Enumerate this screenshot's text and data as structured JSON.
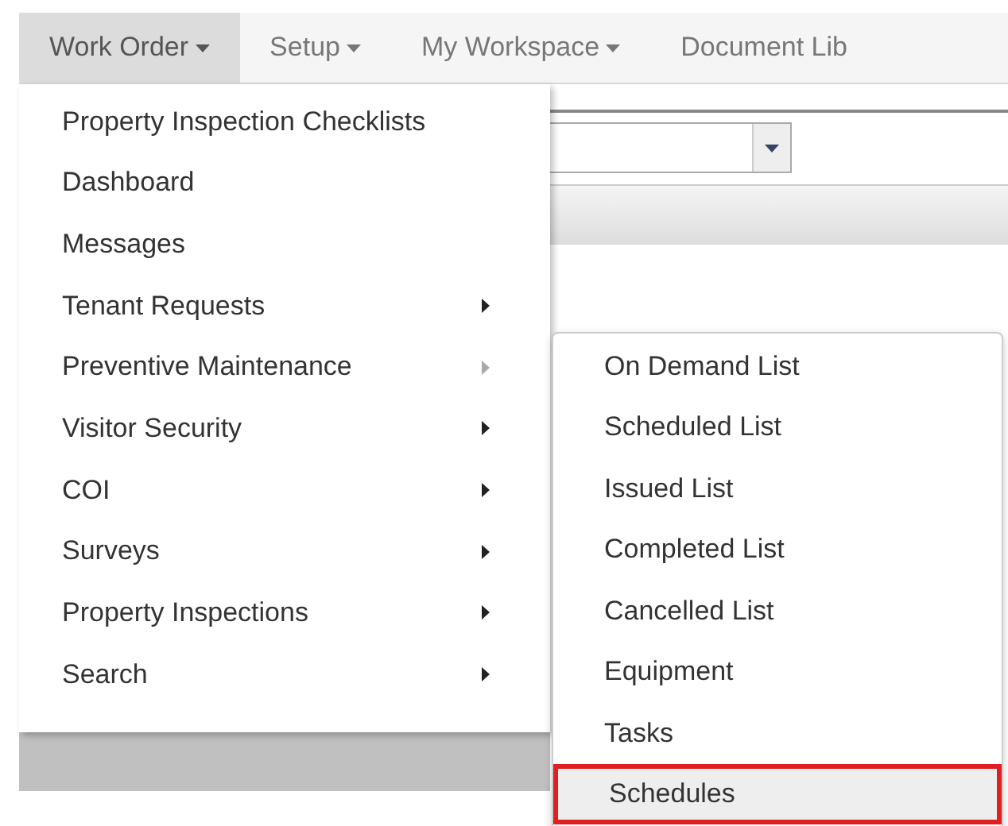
{
  "nav": [
    {
      "label": "Work Order",
      "selected": true,
      "dropdown": true
    },
    {
      "label": "Setup",
      "selected": false,
      "dropdown": true
    },
    {
      "label": "My Workspace",
      "selected": false,
      "dropdown": true
    },
    {
      "label": "Document Lib",
      "selected": false,
      "dropdown": false
    }
  ],
  "menu": [
    {
      "label": "Property Inspection Checklists",
      "kind": "link"
    },
    {
      "label": "Dashboard",
      "kind": "link"
    },
    {
      "label": "Messages",
      "kind": "link"
    },
    {
      "label": "Tenant Requests",
      "kind": "submenu",
      "expanded": false
    },
    {
      "label": "Preventive Maintenance",
      "kind": "submenu",
      "expanded": true
    },
    {
      "label": "Visitor Security",
      "kind": "submenu",
      "expanded": false
    },
    {
      "label": "COI",
      "kind": "submenu",
      "expanded": false
    },
    {
      "label": "Surveys",
      "kind": "submenu",
      "expanded": false
    },
    {
      "label": "Property Inspections",
      "kind": "submenu",
      "expanded": false
    },
    {
      "label": "Search",
      "kind": "submenu",
      "expanded": false
    }
  ],
  "submenu": [
    {
      "label": "On Demand List",
      "selected": false
    },
    {
      "label": "Scheduled List",
      "selected": false
    },
    {
      "label": "Issued List",
      "selected": false
    },
    {
      "label": "Completed List",
      "selected": false
    },
    {
      "label": "Cancelled List",
      "selected": false
    },
    {
      "label": "Equipment",
      "selected": false
    },
    {
      "label": "Tasks",
      "selected": false
    },
    {
      "label": "Schedules",
      "selected": true
    }
  ]
}
